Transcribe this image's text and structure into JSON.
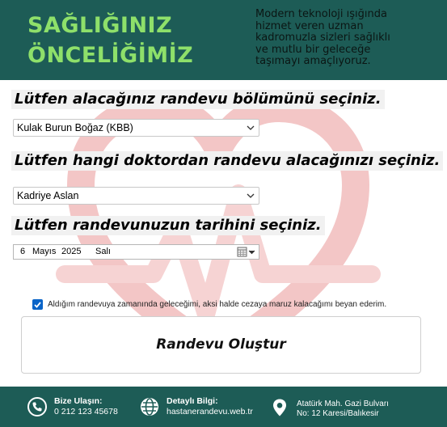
{
  "header": {
    "slogan_line1": "SAĞLIĞINIZ",
    "slogan_line2": "ÖNCELİĞİMİZ",
    "about": "Modern teknoloji ışığında\nhizmet veren uzman\nkadromuzla sizleri sağlıklı\nve mutlu bir geleceğe\ntaşımayı amaçlıyoruz."
  },
  "form": {
    "department_question": "Lütfen alacağınız randevu bölümünü seçiniz.",
    "department_value": "Kulak Burun Boğaz (KBB)",
    "doctor_question": "Lütfen hangi doktordan randevu alacağınızı seçiniz.",
    "doctor_value": "Kadriye Aslan",
    "date_question": "Lütfen randevunuzun tarihini seçiniz.",
    "date": {
      "day": "6",
      "month": "Mayıs",
      "year": "2025",
      "weekday": "Salı"
    },
    "confirm_checked": true,
    "confirm_text": "Aldığım randevuya zamanında geleceğimi, aksi halde cezaya maruz kalacağımı beyan ederim.",
    "submit_label": "Randevu Oluştur"
  },
  "footer": {
    "contact_title": "Bize Ulaşın:",
    "contact_phone": "0 212 123 45678",
    "info_title": "Detaylı Bilgi:",
    "info_site": "hastanerandevu.web.tr",
    "address_line1": "Atatürk Mah. Gazi Bulvarı",
    "address_line2": "No: 12 Karesi/Balıkesir"
  },
  "colors": {
    "brand_dark": "#1d5c56",
    "slogan_green": "#8ee06a",
    "checkbox_blue": "#0a64c8",
    "watermark_pink": "#f3c6c6"
  },
  "icons": [
    "phone-icon",
    "globe-icon",
    "location-pin-icon",
    "calendar-icon",
    "chevron-down-icon",
    "heart-pulse-watermark-icon"
  ]
}
